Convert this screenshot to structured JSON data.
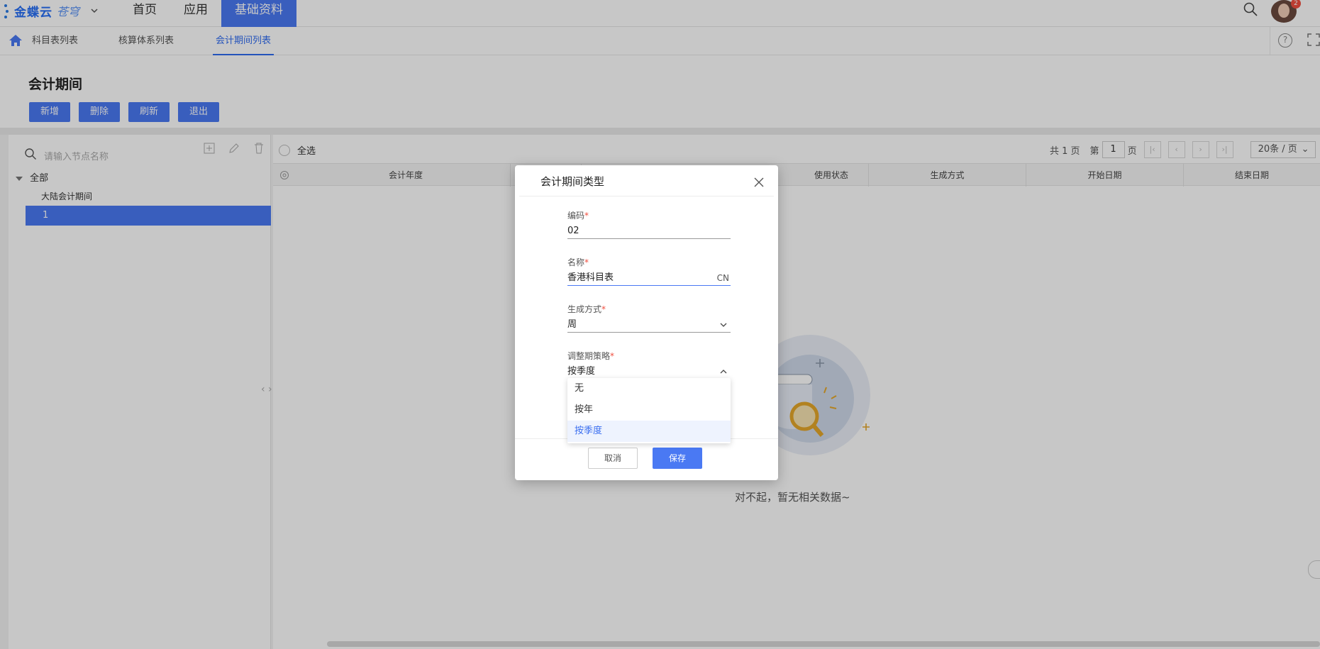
{
  "header": {
    "logo_text": "金蝶云",
    "logo_sub": "苍穹",
    "nav": [
      "首页",
      "应用",
      "基础资料"
    ],
    "avatar_badge": "2"
  },
  "tabs": [
    "科目表列表",
    "核算体系列表",
    "会计期间列表"
  ],
  "page": {
    "title": "会计期间",
    "buttons": [
      "新增",
      "删除",
      "刷新",
      "退出"
    ]
  },
  "tree": {
    "search_placeholder": "请输入节点名称",
    "root": "全部",
    "children": [
      "大陆会计期间",
      "1"
    ]
  },
  "list": {
    "select_all": "全选",
    "pager": {
      "total_text": "共 1 页",
      "page_prefix": "第",
      "page_value": "1",
      "page_suffix": "页",
      "page_size": "20条 / 页"
    },
    "columns": [
      "会计年度",
      "使用状态",
      "生成方式",
      "开始日期",
      "结束日期"
    ],
    "empty_text": "对不起，暂无相关数据~"
  },
  "dialog": {
    "title": "会计期间类型",
    "fields": {
      "code": {
        "label": "编码",
        "required": "*",
        "value": "02"
      },
      "name": {
        "label": "名称",
        "required": "*",
        "value": "香港科目表",
        "suffix": "CN"
      },
      "gen": {
        "label": "生成方式",
        "required": "*",
        "value": "周"
      },
      "adjust": {
        "label": "调整期策略",
        "required": "*",
        "value": "按季度"
      }
    },
    "dropdown_options": [
      "无",
      "按年",
      "按季度"
    ],
    "selected_option": "按季度",
    "cancel_label": "取消",
    "save_label": "保存"
  },
  "colors": {
    "accent": "#4a79f3",
    "required": "#f04f3f"
  }
}
